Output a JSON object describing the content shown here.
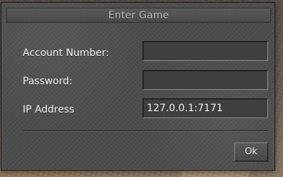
{
  "dialog": {
    "title": "Enter Game",
    "fields": {
      "account_number": {
        "label": "Account Number:",
        "value": "",
        "placeholder": ""
      },
      "password": {
        "label": "Password:",
        "value": "",
        "placeholder": ""
      },
      "ip_address": {
        "label": "IP Address",
        "value": "127.0.0.1:7171",
        "placeholder": ""
      }
    },
    "buttons": {
      "ok": "Ok"
    }
  }
}
